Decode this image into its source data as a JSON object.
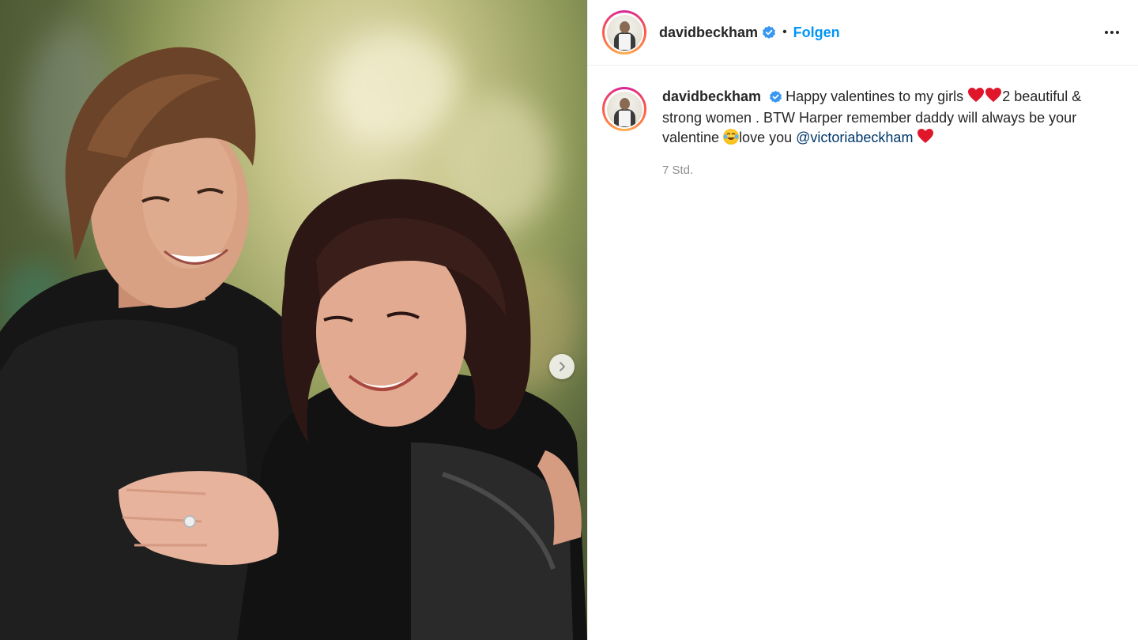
{
  "post": {
    "username": "davidbeckham",
    "follow_label": "Folgen",
    "separator": "•",
    "icons": {
      "verified": "verified-badge-icon",
      "more": "more-options-icon",
      "next": "carousel-next-icon"
    },
    "caption": {
      "username": "davidbeckham",
      "part1": "Happy valentines to my girls ",
      "part2": "2 beautiful & strong women . BTW Harper remember daddy will always be your valentine ",
      "part3": "love you ",
      "mention": "@victoriabeckham",
      "emojis": [
        "red-heart",
        "red-heart",
        "face-with-tears-of-joy",
        "red-heart"
      ]
    },
    "timestamp": "7 Std."
  },
  "colors": {
    "follow": "#0095f6",
    "verified": "#3897f0",
    "mention": "#00376b",
    "timestamp": "#8e8e8e",
    "heart": "#e0162b"
  }
}
